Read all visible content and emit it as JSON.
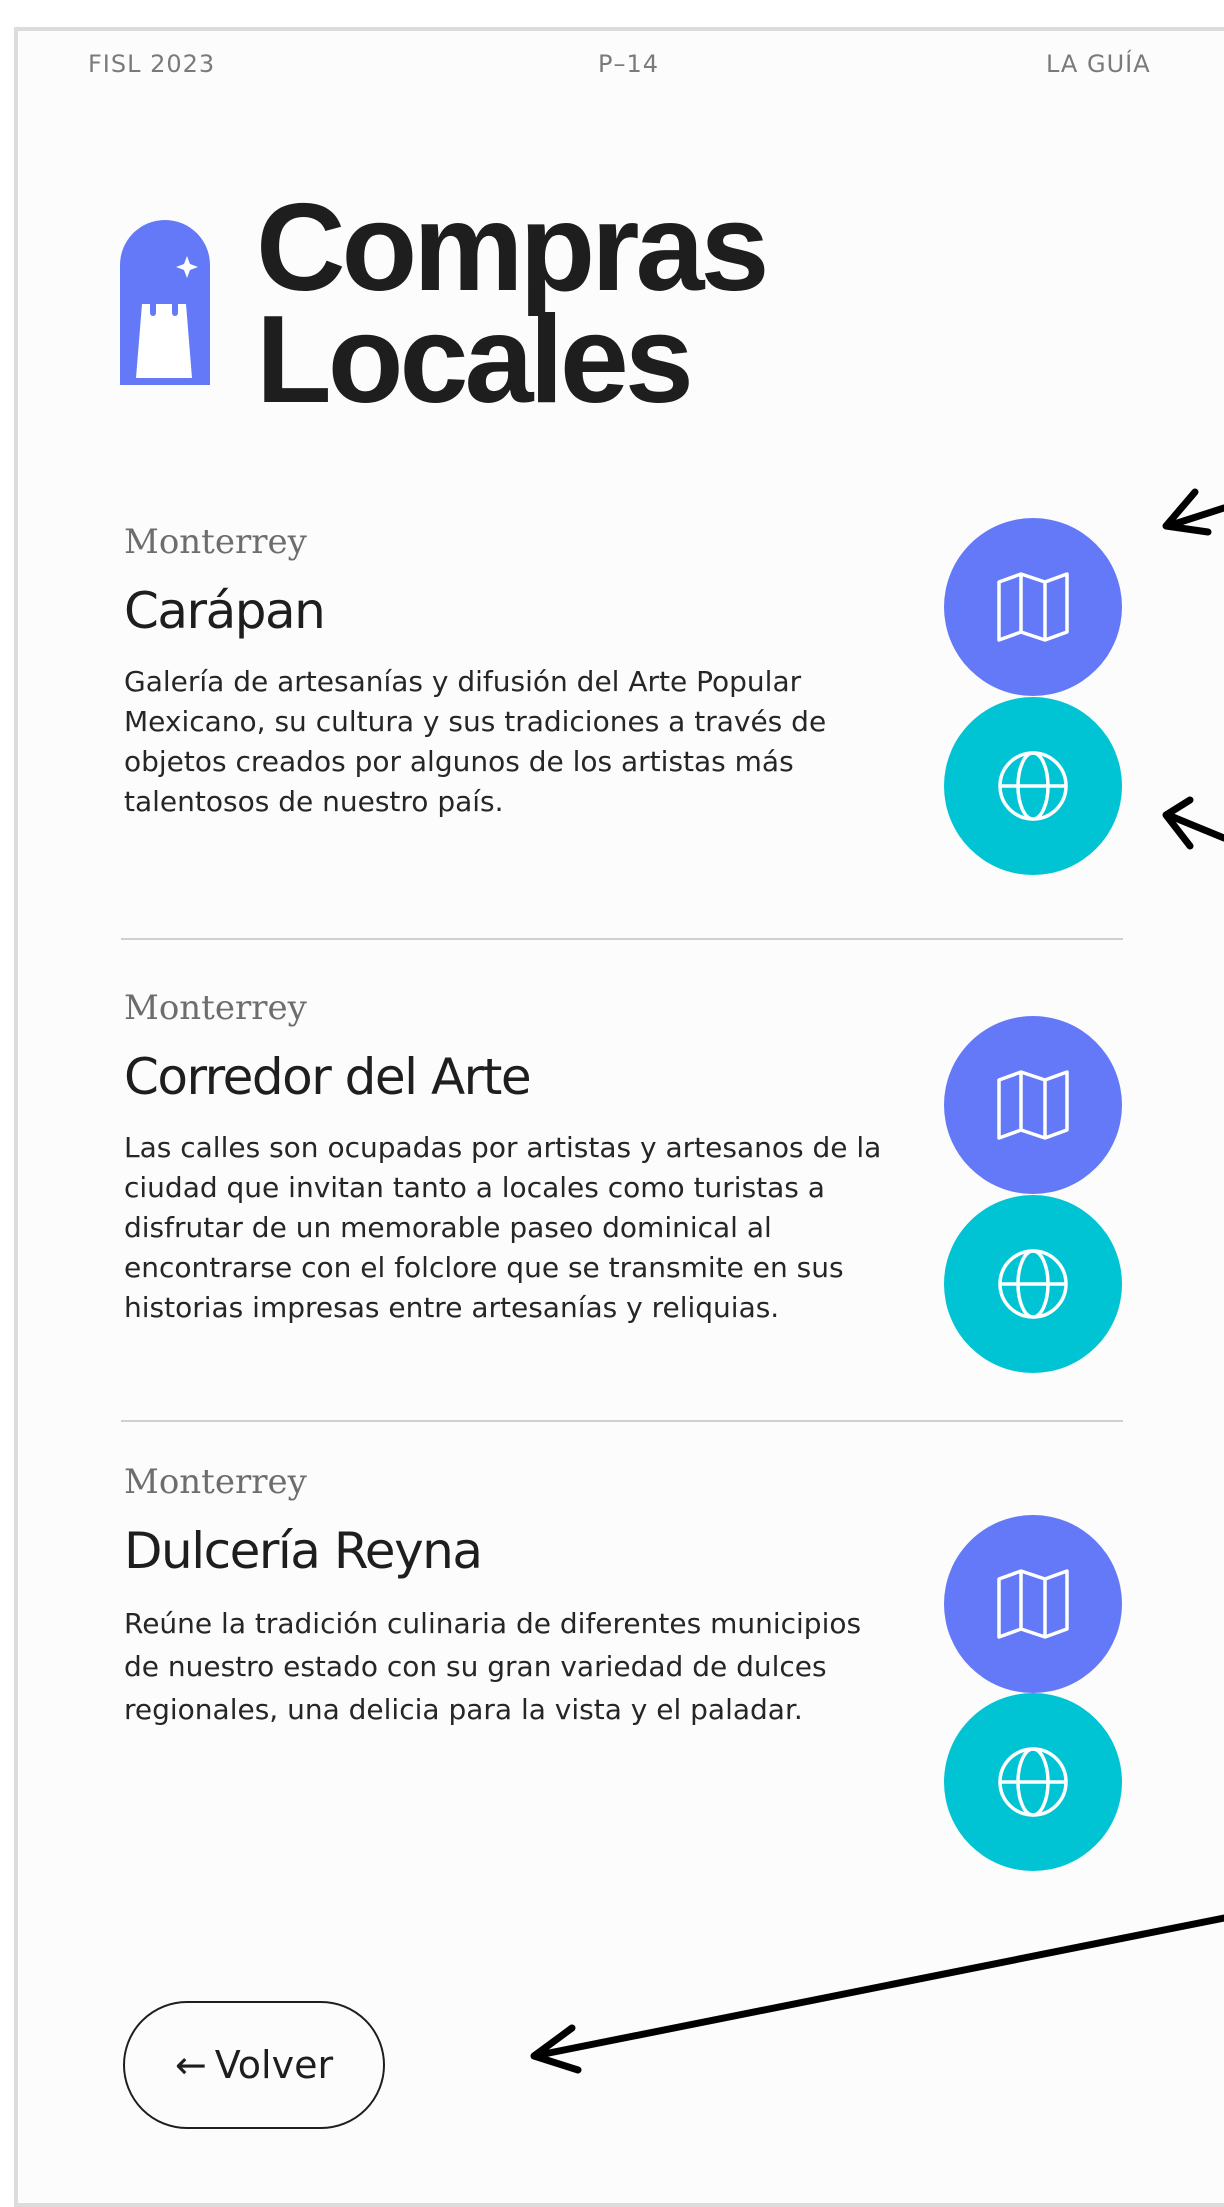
{
  "header": {
    "left": "FISL 2023",
    "center": "P–14",
    "right": "LA GUÍA"
  },
  "title": {
    "line1": "Compras",
    "line2": "Locales",
    "icon": "shopping-bag-icon"
  },
  "items": [
    {
      "city": "Monterrey",
      "name": "Carápan",
      "description": "Galería de artesanías y difusión del Arte Popular Mexicano, su cultura y sus tradiciones a través de objetos creados por algunos de los artistas más talentosos de nuestro país.",
      "map_icon": "map-icon",
      "web_icon": "globe-icon"
    },
    {
      "city": "Monterrey",
      "name": "Corredor del Arte",
      "description": "Las calles son ocupadas por artistas y artesanos de la ciudad que invitan tanto a locales como turistas a disfrutar de un memorable paseo dominical al encontrarse con el folclore que se transmite en sus historias impresas entre artesanías y reliquias.",
      "map_icon": "map-icon",
      "web_icon": "globe-icon"
    },
    {
      "city": "Monterrey",
      "name": "Dulcería Reyna",
      "description": "Reúne la tradición culinaria de diferentes municipios de nuestro estado con su gran variedad de dulces regionales, una delicia para la vista y el paladar.",
      "map_icon": "map-icon",
      "web_icon": "globe-icon"
    }
  ],
  "back_button": {
    "arrow": "←",
    "label": "Volver"
  },
  "colors": {
    "map_button": "#6479f8",
    "web_button": "#00c4d4",
    "text": "#1e1e1e"
  }
}
